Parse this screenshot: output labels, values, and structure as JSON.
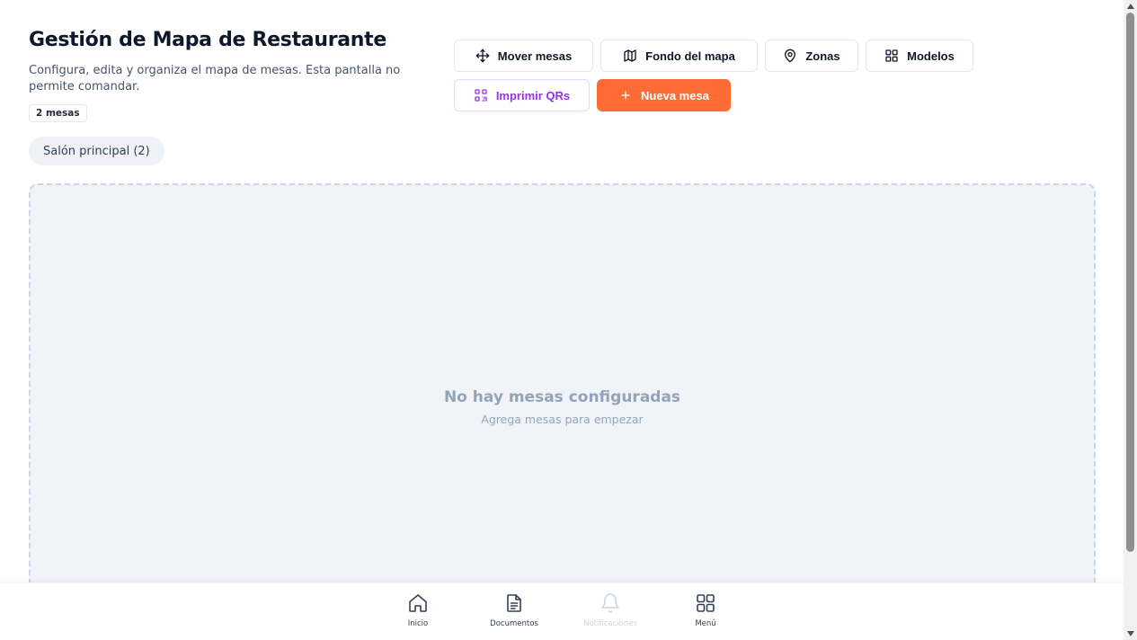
{
  "header": {
    "title": "Gestión de Mapa de Restaurante",
    "subtitle": "Configura, edita y organiza el mapa de mesas. Esta pantalla no permite comandar.",
    "count_badge": "2 mesas"
  },
  "toolbar": {
    "move_tables": "Mover mesas",
    "map_background": "Fondo del mapa",
    "zones": "Zonas",
    "models": "Modelos",
    "print_qrs": "Imprimir QRs",
    "new_table": "Nueva mesa"
  },
  "zone_tabs": [
    {
      "label": "Salón principal (2)"
    }
  ],
  "map": {
    "empty_title": "No hay mesas configuradas",
    "empty_subtitle": "Agrega mesas para empezar"
  },
  "bottom_nav": {
    "items": [
      {
        "label": "Inicio",
        "icon": "home-icon"
      },
      {
        "label": "Documentos",
        "icon": "document-icon"
      },
      {
        "label": "Notificaciones",
        "icon": "bell-icon"
      },
      {
        "label": "Menú",
        "icon": "grid-icon"
      }
    ]
  },
  "colors": {
    "accent": "#ff6b35",
    "qr_purple": "#9333ea",
    "map_background": "#f0f4f9",
    "muted_text": "#94a3b8"
  }
}
